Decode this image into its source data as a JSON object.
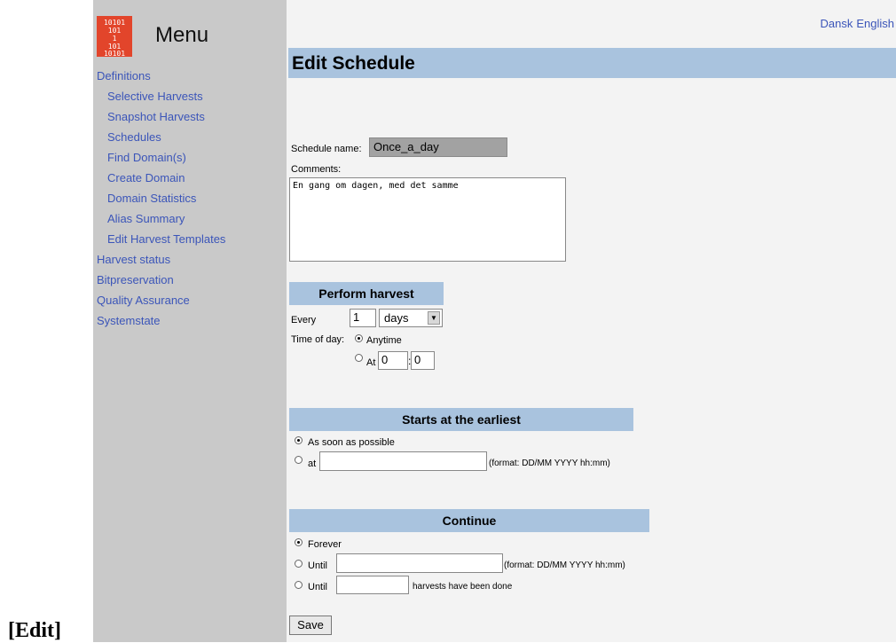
{
  "sidebar": {
    "menu_title": "Menu",
    "items": [
      {
        "label": "Definitions"
      },
      {
        "label": "Selective Harvests"
      },
      {
        "label": "Snapshot Harvests"
      },
      {
        "label": "Schedules"
      },
      {
        "label": "Find Domain(s)"
      },
      {
        "label": "Create Domain"
      },
      {
        "label": "Domain Statistics"
      },
      {
        "label": "Alias Summary"
      },
      {
        "label": "Edit Harvest Templates"
      },
      {
        "label": "Harvest status"
      },
      {
        "label": "Bitpreservation"
      },
      {
        "label": "Quality Assurance"
      },
      {
        "label": "Systemstate"
      }
    ]
  },
  "language": {
    "dansk": "Dansk",
    "english": "English"
  },
  "page": {
    "title": "Edit Schedule"
  },
  "form": {
    "schedule_name_label": "Schedule name:",
    "schedule_name_value": "Once_a_day",
    "comments_label": "Comments:",
    "comments_value": "En gang om dagen, med det samme"
  },
  "perform": {
    "header": "Perform harvest",
    "every_label": "Every",
    "every_value": "1",
    "unit_value": "days",
    "time_of_day_label": "Time of day:",
    "anytime_label": "Anytime",
    "at_label": "At",
    "hour_value": "0",
    "minute_value": "0",
    "separator": ":"
  },
  "starts": {
    "header": "Starts at the earliest",
    "asap_label": "As soon as possible",
    "at_label": "at",
    "format_hint": "(format: DD/MM YYYY hh:mm)"
  },
  "continue": {
    "header": "Continue",
    "forever_label": "Forever",
    "until_label": "Until",
    "format_hint": "(format: DD/MM YYYY hh:mm)",
    "until_count_label": "Until",
    "harvests_suffix": "harvests have been done"
  },
  "save_label": "Save",
  "edit_link": "[Edit]"
}
